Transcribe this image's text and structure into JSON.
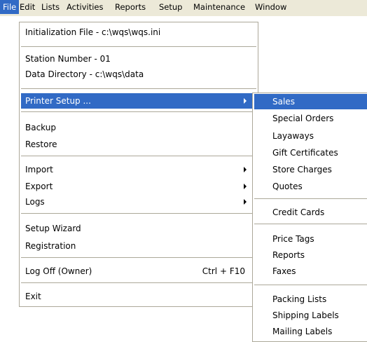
{
  "menubar": {
    "items": [
      "File",
      "Edit",
      "Lists",
      "Activities",
      "Reports",
      "Setup",
      "Maintenance",
      "Window"
    ]
  },
  "file_menu": {
    "initialization_file": "Initialization File - c:\\wqs\\wqs.ini",
    "station_number": "Station Number - 01",
    "data_directory": "Data Directory  - c:\\wqs\\data",
    "printer_setup": "Printer Setup ...",
    "backup": "Backup",
    "restore": "Restore",
    "import": "Import",
    "export": "Export",
    "logs": "Logs",
    "setup_wizard": "Setup Wizard",
    "registration": "Registration",
    "log_off": "Log Off  (Owner)",
    "log_off_shortcut": "Ctrl + F10",
    "exit": "Exit"
  },
  "printer_submenu": {
    "sales": "Sales",
    "special_orders": "Special Orders",
    "layaways": "Layaways",
    "gift_certificates": "Gift Certificates",
    "store_charges": "Store Charges",
    "quotes": "Quotes",
    "credit_cards": "Credit Cards",
    "price_tags": "Price Tags",
    "reports": "Reports",
    "faxes": "Faxes",
    "packing_lists": "Packing Lists",
    "shipping_labels": "Shipping Labels",
    "mailing_labels": "Mailing Labels"
  }
}
